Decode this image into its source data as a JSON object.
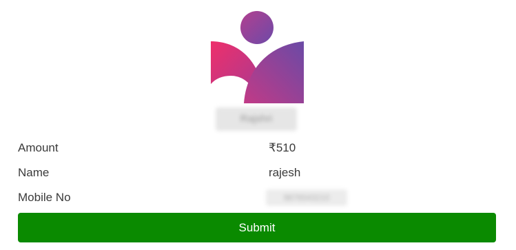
{
  "brand": {
    "name": "Rajshri"
  },
  "details": [
    {
      "label": "Amount",
      "value": "₹510"
    },
    {
      "label": "Name",
      "value": "rajesh"
    },
    {
      "label": "Mobile No",
      "value": "9876543210"
    }
  ],
  "submit": {
    "label": "Submit"
  },
  "colors": {
    "accent_pink": "#e8306e",
    "accent_purple": "#6d4aa8",
    "submit_green": "#0a8a00",
    "text": "#3a3a3a"
  }
}
